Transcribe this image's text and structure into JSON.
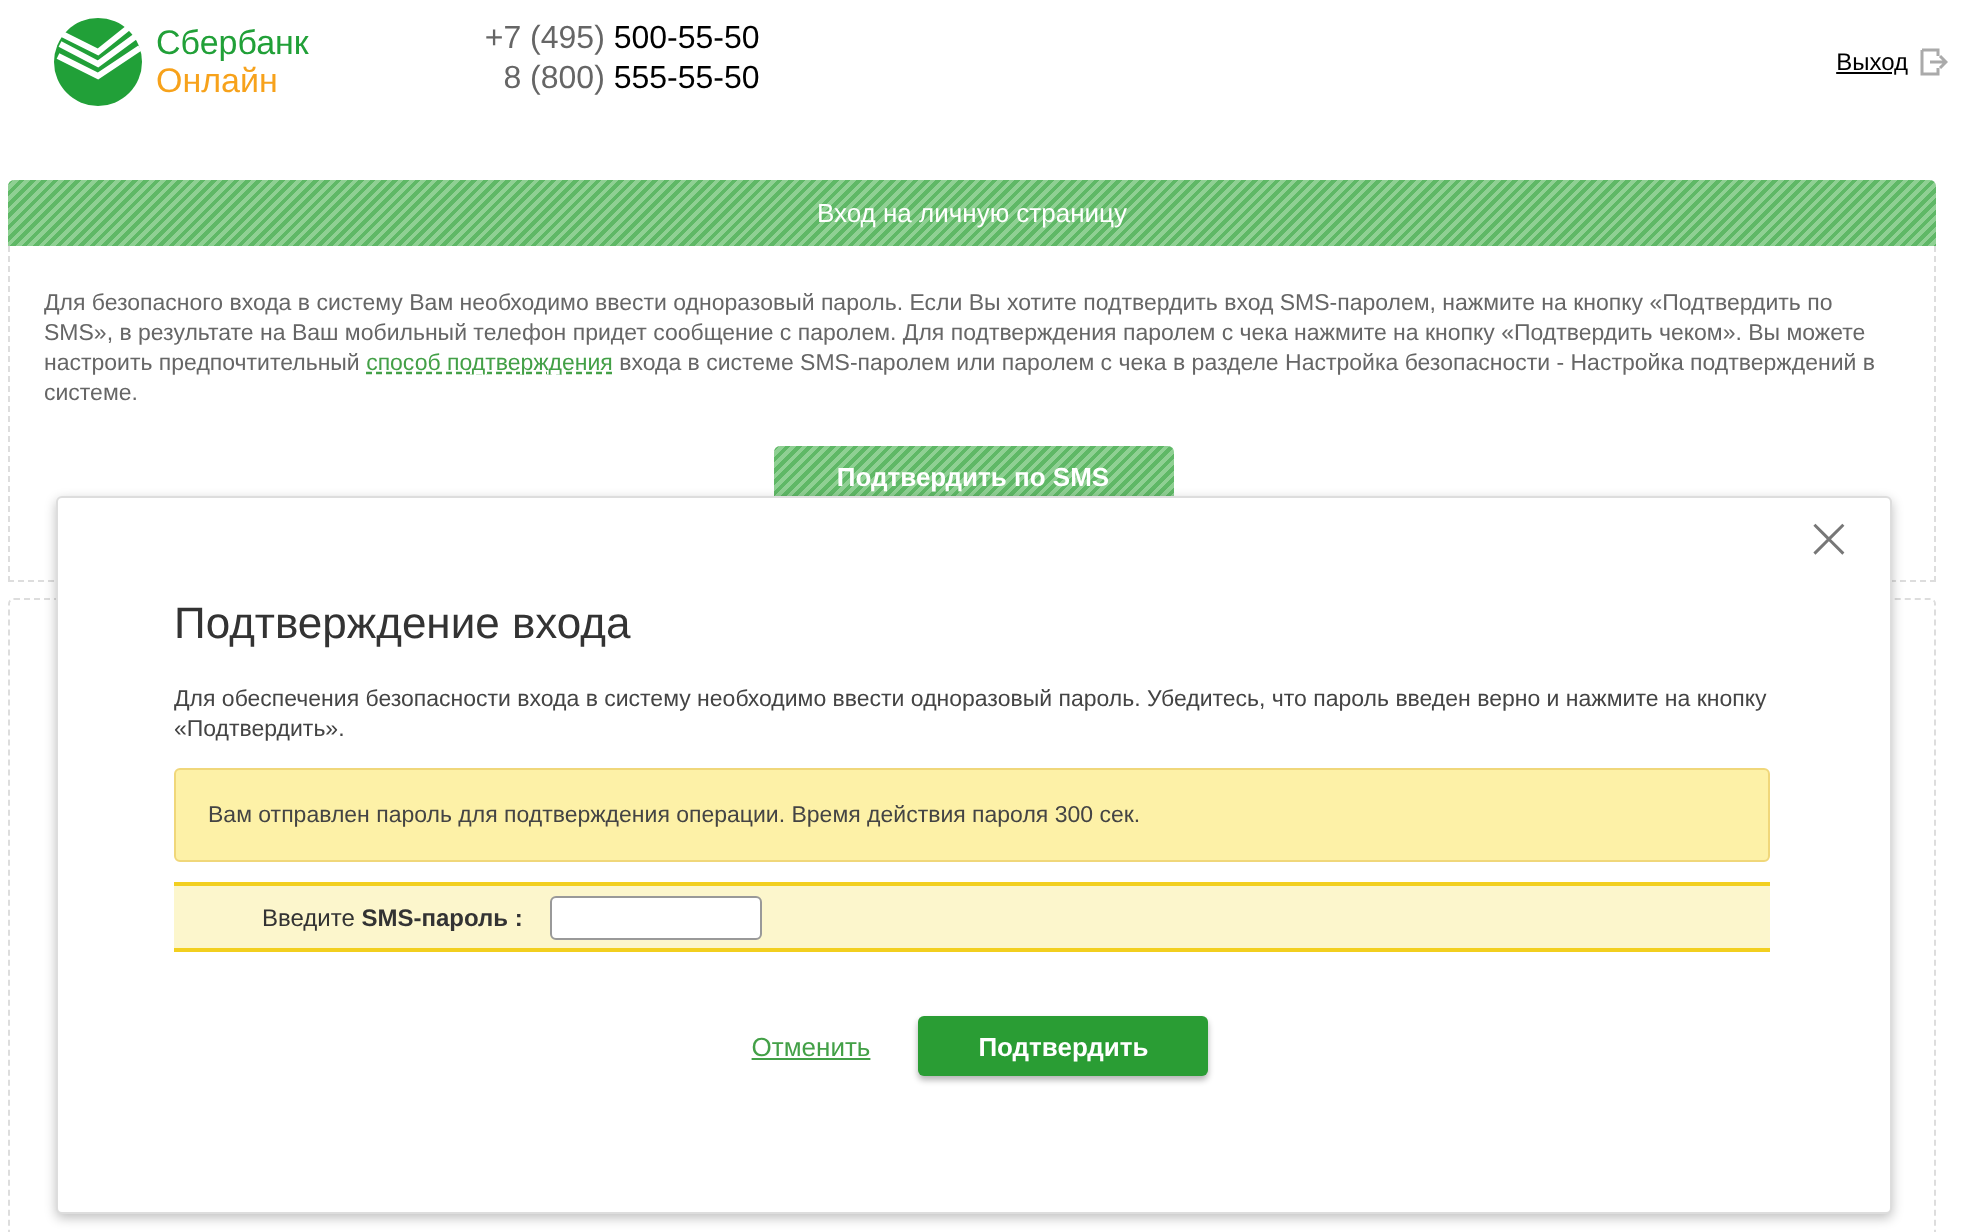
{
  "header": {
    "brand_line_1": "Сбербанк",
    "brand_line_2": "Онлайн",
    "phones": [
      {
        "code": "+7 (495)",
        "number": "500-55-50"
      },
      {
        "code": "8 (800)",
        "number": "555-55-50"
      }
    ],
    "logout": "Выход"
  },
  "banner": {
    "title": "Вход на личную страницу"
  },
  "intro": {
    "text_before": "Для безопасного входа в систему Вам необходимо ввести одноразовый пароль. Если Вы хотите подтвердить вход SMS-паролем, нажмите на кнопку «Подтвердить по SMS», в результате на Ваш мобильный телефон придет сообщение с паролем. Для подтверждения паролем с чека нажмите на кнопку «Подтвердить чеком». Вы можете настроить предпочтительный",
    "link": "способ подтверждения",
    "text_after": "входа в системе SMS-паролем или паролем с чека в разделе Настройка безопасности - Настройка подтверждений в системе.",
    "button": "Подтвердить по SMS"
  },
  "dialog": {
    "close": "×",
    "title": "Подтверждение входа",
    "description": "Для обеспечения безопасности входа в систему необходимо ввести одноразовый пароль. Убедитесь, что пароль введен верно и нажмите на кнопку «Подтвердить».",
    "notice": "Вам отправлен пароль для подтверждения операции. Время действия пароля 300 сек.",
    "field_label": "Введите **SMS-пароль :**",
    "cancel": "Отменить",
    "confirm": "Подтвердить"
  }
}
